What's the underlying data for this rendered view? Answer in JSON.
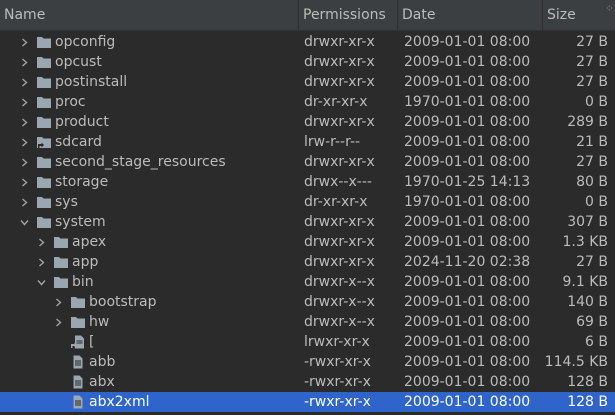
{
  "columns": {
    "name": "Name",
    "permissions": "Permissions",
    "date": "Date",
    "size": "Size"
  },
  "colors": {
    "background": "#2b2b2b",
    "header": "#3c3f41",
    "text": "#bbbbbb",
    "selection": "#2f65ca",
    "folder_icon": "#9aa7b0"
  },
  "rows": [
    {
      "depth": 0,
      "arrow": "right",
      "icon": "folder-icon",
      "name": "opconfig",
      "permissions": "drwxr-xr-x",
      "date": "2009-01-01 08:00",
      "size": "27 B"
    },
    {
      "depth": 0,
      "arrow": "right",
      "icon": "folder-icon",
      "name": "opcust",
      "permissions": "drwxr-xr-x",
      "date": "2009-01-01 08:00",
      "size": "27 B"
    },
    {
      "depth": 0,
      "arrow": "right",
      "icon": "folder-icon",
      "name": "postinstall",
      "permissions": "drwxr-xr-x",
      "date": "2009-01-01 08:00",
      "size": "27 B"
    },
    {
      "depth": 0,
      "arrow": "right",
      "icon": "folder-icon",
      "name": "proc",
      "permissions": "dr-xr-xr-x",
      "date": "1970-01-01 08:00",
      "size": "0 B"
    },
    {
      "depth": 0,
      "arrow": "right",
      "icon": "folder-icon",
      "name": "product",
      "permissions": "drwxr-xr-x",
      "date": "2009-01-01 08:00",
      "size": "289 B"
    },
    {
      "depth": 0,
      "arrow": "right",
      "icon": "folder-link-icon",
      "name": "sdcard",
      "permissions": "lrw-r--r--",
      "date": "2009-01-01 08:00",
      "size": "21 B"
    },
    {
      "depth": 0,
      "arrow": "right",
      "icon": "folder-icon",
      "name": "second_stage_resources",
      "permissions": "drwxr-xr-x",
      "date": "2009-01-01 08:00",
      "size": "27 B"
    },
    {
      "depth": 0,
      "arrow": "right",
      "icon": "folder-icon",
      "name": "storage",
      "permissions": "drwx--x---",
      "date": "1970-01-25 14:13",
      "size": "80 B"
    },
    {
      "depth": 0,
      "arrow": "right",
      "icon": "folder-icon",
      "name": "sys",
      "permissions": "dr-xr-xr-x",
      "date": "1970-01-01 08:00",
      "size": "0 B"
    },
    {
      "depth": 0,
      "arrow": "down",
      "icon": "folder-icon",
      "name": "system",
      "permissions": "drwxr-xr-x",
      "date": "2009-01-01 08:00",
      "size": "307 B"
    },
    {
      "depth": 1,
      "arrow": "right",
      "icon": "folder-icon",
      "name": "apex",
      "permissions": "drwxr-xr-x",
      "date": "2009-01-01 08:00",
      "size": "1.3 KB"
    },
    {
      "depth": 1,
      "arrow": "right",
      "icon": "folder-icon",
      "name": "app",
      "permissions": "drwxr-xr-x",
      "date": "2024-11-20 02:38",
      "size": "27 B"
    },
    {
      "depth": 1,
      "arrow": "down",
      "icon": "folder-icon",
      "name": "bin",
      "permissions": "drwxr-x--x",
      "date": "2009-01-01 08:00",
      "size": "9.1 KB"
    },
    {
      "depth": 2,
      "arrow": "right",
      "icon": "folder-icon",
      "name": "bootstrap",
      "permissions": "drwxr-x--x",
      "date": "2009-01-01 08:00",
      "size": "140 B"
    },
    {
      "depth": 2,
      "arrow": "right",
      "icon": "folder-icon",
      "name": "hw",
      "permissions": "drwxr-x--x",
      "date": "2009-01-01 08:00",
      "size": "69 B"
    },
    {
      "depth": 2,
      "arrow": "none",
      "icon": "file-link-icon",
      "name": "[",
      "permissions": "lrwxr-xr-x",
      "date": "2009-01-01 08:00",
      "size": "6 B"
    },
    {
      "depth": 2,
      "arrow": "none",
      "icon": "file-icon",
      "name": "abb",
      "permissions": "-rwxr-xr-x",
      "date": "2009-01-01 08:00",
      "size": "114.5 KB"
    },
    {
      "depth": 2,
      "arrow": "none",
      "icon": "file-icon",
      "name": "abx",
      "permissions": "-rwxr-xr-x",
      "date": "2009-01-01 08:00",
      "size": "128 B"
    },
    {
      "depth": 2,
      "arrow": "none",
      "icon": "file-icon",
      "name": "abx2xml",
      "permissions": "-rwxr-xr-x",
      "date": "2009-01-01 08:00",
      "size": "128 B",
      "selected": true
    }
  ]
}
